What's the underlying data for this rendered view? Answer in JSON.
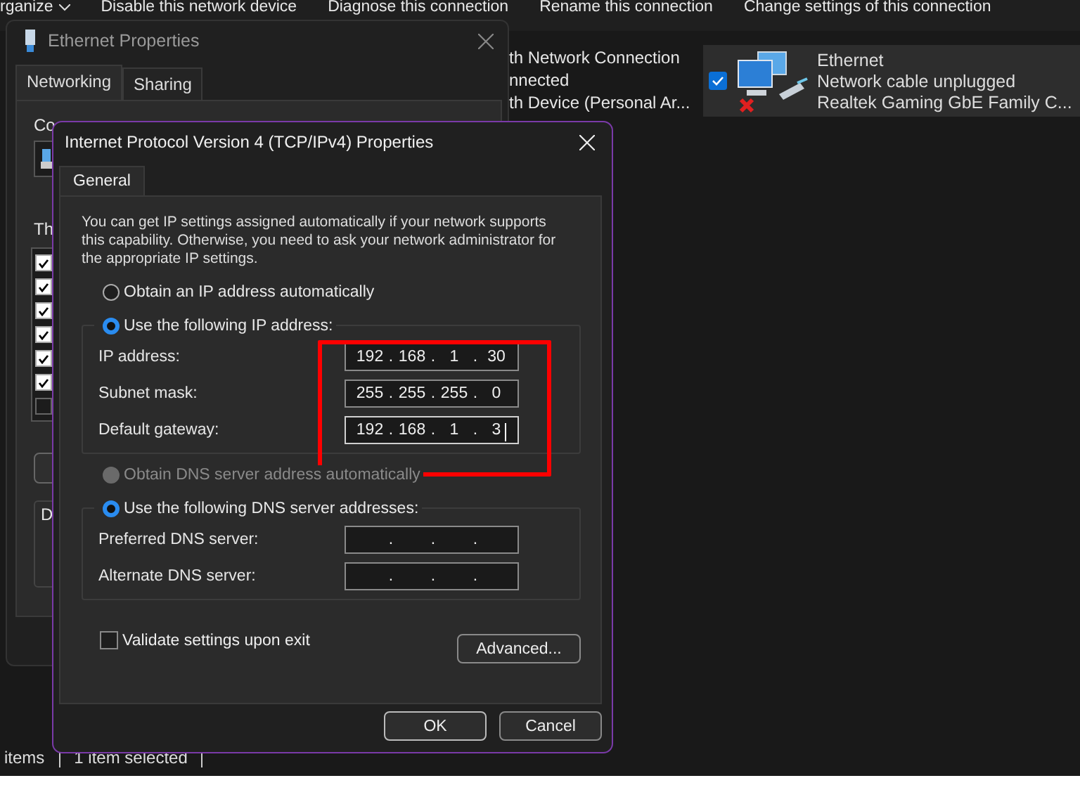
{
  "toolbar": {
    "items": [
      {
        "label": "rganize",
        "kind": "menu"
      },
      {
        "label": "Disable this network device",
        "kind": "command"
      },
      {
        "label": "Diagnose this connection",
        "kind": "command"
      },
      {
        "label": "Rename this connection",
        "kind": "command"
      },
      {
        "label": "Change settings of this connection",
        "kind": "command"
      }
    ]
  },
  "connections": [
    {
      "kind": "partial",
      "lines": [
        "th Network Connection",
        "nnected",
        "th Device (Personal Ar..."
      ]
    },
    {
      "kind": "tile",
      "name": "Ethernet",
      "status": "Network cable unplugged",
      "device": "Realtek Gaming GbE Family C...",
      "checked": true,
      "selected": true
    }
  ],
  "ethernet_window": {
    "title": "Ethernet Properties",
    "tabs": [
      {
        "label": "Networking",
        "selected": true
      },
      {
        "label": "Sharing",
        "selected": false
      }
    ],
    "connect_label": "Co",
    "items_label": "Th",
    "items": [
      {
        "checked": true
      },
      {
        "checked": true
      },
      {
        "checked": true
      },
      {
        "checked": true
      },
      {
        "checked": true
      },
      {
        "checked": true
      },
      {
        "checked": false
      }
    ],
    "group_label": "D"
  },
  "status_bar": [
    "items",
    "1 item selected"
  ],
  "dialog": {
    "title": "Internet Protocol Version 4 (TCP/IPv4) Properties",
    "tabs": [
      {
        "label": "General",
        "selected": true
      }
    ],
    "intro": "You can get IP settings assigned automatically if your network supports this capability. Otherwise, you need to ask your network administrator for the appropriate IP settings.",
    "separator": ".",
    "ip_options": [
      {
        "label": "Obtain an IP address automatically",
        "selected": false,
        "disabled": false
      },
      {
        "label": "Use the following IP address:",
        "selected": true,
        "disabled": false,
        "fields": [
          {
            "label": "IP address:",
            "octets": [
              "192",
              "168",
              "1",
              "30"
            ],
            "focused": false
          },
          {
            "label": "Subnet mask:",
            "octets": [
              "255",
              "255",
              "255",
              "0"
            ],
            "focused": false
          },
          {
            "label": "Default gateway:",
            "octets": [
              "192",
              "168",
              "1",
              "3"
            ],
            "focused": true
          }
        ]
      }
    ],
    "dns_options": [
      {
        "label": "Obtain DNS server address automatically",
        "selected": false,
        "disabled": true
      },
      {
        "label": "Use the following DNS server addresses:",
        "selected": true,
        "disabled": false,
        "fields": [
          {
            "label": "Preferred DNS server:",
            "focused": false
          },
          {
            "label": "Alternate DNS server:",
            "focused": false
          }
        ]
      }
    ],
    "validate": {
      "label": "Validate settings upon exit",
      "checked": false
    },
    "advanced_button": "Advanced...",
    "buttons": [
      "OK",
      "Cancel"
    ]
  },
  "highlight": {
    "kind": "rectangle",
    "color": "#ff0000"
  }
}
